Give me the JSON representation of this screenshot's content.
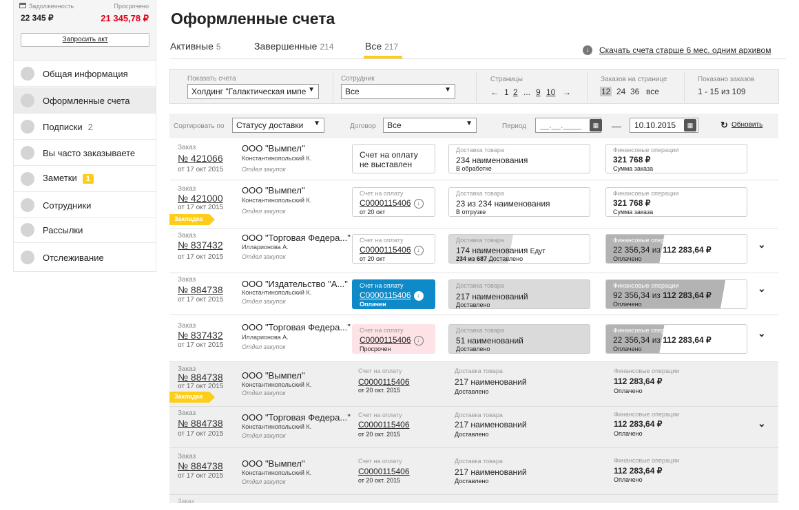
{
  "sidebar": {
    "debt_label": "Задолженность",
    "debt_value": "22 345 ₽",
    "overdue_label": "Просрочено",
    "overdue_value": "21 345,78 ₽",
    "request_label": "Запросить акт",
    "items": [
      {
        "label": "Общая информация"
      },
      {
        "label": "Оформленные счета"
      },
      {
        "label": "Подписки",
        "count": "2"
      },
      {
        "label": "Вы часто заказываете"
      },
      {
        "label": "Заметки",
        "badge": "1"
      },
      {
        "label": "Сотрудники"
      },
      {
        "label": "Рассылки"
      },
      {
        "label": "Отслеживание"
      }
    ]
  },
  "page_title": "Оформленные счета",
  "tabs": [
    {
      "label": "Активные",
      "count": "5"
    },
    {
      "label": "Завершенные",
      "count": "214"
    },
    {
      "label": "Все",
      "count": "217"
    }
  ],
  "download_link": "Скачать счета старше 6 мес. одним архивом",
  "filter": {
    "show_label": "Показать счета",
    "show_value": "Холдинг \"Галактическая импе",
    "employee_label": "Сотрудник",
    "employee_value": "Все",
    "pages_label": "Страницы",
    "prev": "←",
    "p1": "1",
    "p2": "2",
    "dots": "...",
    "p9": "9",
    "p10": "10",
    "next": "→",
    "per_page_label": "Заказов на странице",
    "pp12": "12",
    "pp24": "24",
    "pp36": "36",
    "pp_all": "все",
    "shown_label": "Показано заказов",
    "shown_value": "1 - 15 из 109"
  },
  "sort": {
    "sort_label": "Сортировать по",
    "sort_value": "Статусу доставки",
    "contract_label": "Договор",
    "contract_value": "Все",
    "period_label": "Период",
    "date_from": "__.__.____",
    "dash": "—",
    "date_to": "10.10.2015",
    "refresh": "Обновить"
  },
  "common": {
    "order_label": "Заказ",
    "invoice_label": "Счет на оплату",
    "delivery_label": "Доставка товара",
    "finance_label": "Финансовые операции",
    "bookmark": "Закладка"
  },
  "rows": [
    {
      "num": "№ 421066",
      "date": "от 17 окт 2015",
      "company": "ООО \"Вымпел\"",
      "person": "Константинопольский К.",
      "dept": "Отдел закупок",
      "invoice": "Счет на оплату\nне выставлен",
      "delivery": "234 наименования",
      "delivery_status": "В обработке",
      "finance": "321 768 ₽",
      "finance_status": "Сумма заказа"
    },
    {
      "num": "№ 421000",
      "date": "от 17 окт 2015",
      "company": "ООО \"Вымпел\"",
      "person": "Константинопольский К.",
      "dept": "Отдел закупок",
      "invoice": "C0000115406",
      "invoice_date": "от 20 окт",
      "delivery": "23 из 234 наименования",
      "delivery_status": "В отгрузке",
      "finance": "321 768 ₽",
      "finance_status": "Сумма заказа"
    },
    {
      "num": "№ 837432",
      "date": "от 17 окт 2015",
      "company": "ООО \"Торговая Федера...\"",
      "person": "Илларионова А.",
      "dept": "Отдел закупок",
      "invoice": "C0000115406",
      "invoice_date": "от 20 окт",
      "delivery": "174 наименования",
      "delivery_extra": "Едут",
      "delivery_status": "234 из 687",
      "delivery_status2": "Доставлено",
      "finance_a": "22 356,34 из ",
      "finance_b": "112 283,64 ₽",
      "finance_status": "Оплачено"
    },
    {
      "num": "№ 884738",
      "date": "от 17 окт 2015",
      "company": "ООО \"Издательство \"А...\"",
      "person": "Константинопольский К.",
      "dept": "Отдел закупок",
      "invoice": "C0000115406",
      "invoice_status": "Оплачен",
      "delivery": "217 наименований",
      "delivery_status": "Доставлено",
      "finance_a": "92 356,34 из ",
      "finance_b": "112 283,64 ₽",
      "finance_status": "Оплачено"
    },
    {
      "num": "№ 837432",
      "date": "от 17 окт 2015",
      "company": "ООО \"Торговая Федера...\"",
      "person": "Илларионова А.",
      "dept": "Отдел закупок",
      "invoice": "C0000115406",
      "invoice_status": "Просрочен",
      "delivery": "51 наименований",
      "delivery_status": "Доставлено",
      "finance_a": "22 356,34 из ",
      "finance_b": "112 283,64 ₽",
      "finance_status": "Оплачено"
    },
    {
      "num": "№ 884738",
      "date": "от 17 окт 2015",
      "company": "ООО \"Вымпел\"",
      "person": "Константинопольский К.",
      "dept": "Отдел закупок",
      "invoice": "C0000115406",
      "invoice_date": "от 20 окт. 2015",
      "delivery": "217 наименований",
      "delivery_status": "Доставлено",
      "finance": "112 283,64 ₽",
      "finance_status": "Оплачено"
    },
    {
      "num": "№ 884738",
      "date": "от 17 окт 2015",
      "company": "ООО \"Торговая Федера...\"",
      "person": "Константинопольский К.",
      "dept": "Отдел закупок",
      "invoice": "C0000115406",
      "invoice_date": "от 20 окт. 2015",
      "delivery": "217 наименований",
      "delivery_status": "Доставлено",
      "finance": "112 283,64 ₽",
      "finance_status": "Оплачено"
    },
    {
      "num": "№ 884738",
      "date": "от 17 окт 2015",
      "company": "ООО \"Вымпел\"",
      "person": "Константинопольский К.",
      "dept": "Отдел закупок",
      "invoice": "C0000115406",
      "invoice_date": "от 20 окт. 2015",
      "delivery": "217 наименований",
      "delivery_status": "Доставлено",
      "finance": "112 283,64 ₽",
      "finance_status": "Оплачено"
    }
  ],
  "colors": {
    "accent": "#fecd1a",
    "overdue": "#e0001b",
    "paid": "#0f8ac8",
    "overdue_bg": "#fde3e6"
  },
  "icons": {
    "download": "download-icon",
    "calendar": "calendar-icon",
    "refresh": "refresh-icon",
    "chevron": "chevron-down-icon",
    "wallet": "wallet-icon"
  }
}
